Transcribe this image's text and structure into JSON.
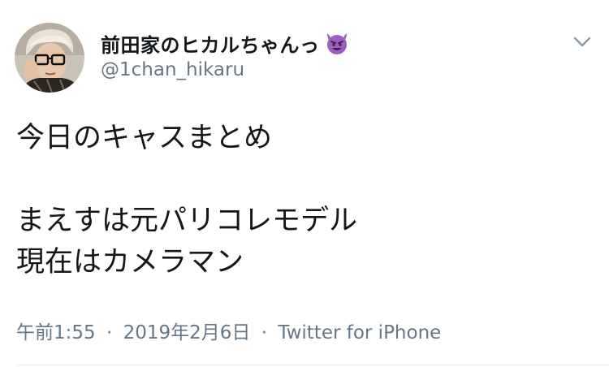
{
  "user": {
    "display_name": "前田家のヒカルちゃんっ",
    "handle": "@1chan_hikaru",
    "name_emoji": "smiling-devil-icon"
  },
  "tweet": {
    "lines": [
      "今日のキャスまとめ",
      "",
      "まえすは元パリコレモデル",
      "現在はカメラマン"
    ]
  },
  "meta": {
    "time": "午前1:55",
    "separator": "·",
    "date": "2019年2月6日",
    "source": "Twitter for iPhone"
  },
  "colors": {
    "text": "#14171a",
    "secondary": "#657786",
    "emoji_purple": "#9b5fc0",
    "divider": "#e6ecf0"
  },
  "icons": {
    "more": "chevron-down-icon"
  }
}
